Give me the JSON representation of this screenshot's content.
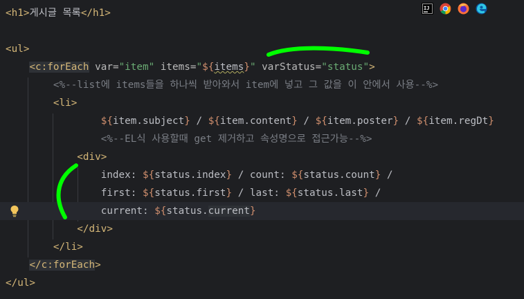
{
  "lines": [
    {
      "parts": [
        {
          "c": "tag",
          "t": "<h1>"
        },
        {
          "c": "txt",
          "t": "게시글 목록"
        },
        {
          "c": "tag",
          "t": "</h1>"
        }
      ]
    },
    {
      "parts": []
    },
    {
      "parts": [
        {
          "c": "tag",
          "t": "<ul>"
        }
      ]
    },
    {
      "parts": [
        {
          "c": "txt",
          "t": "    "
        },
        {
          "c": "tag hl",
          "t": "<c:forEach"
        },
        {
          "c": "attr",
          "t": " var="
        },
        {
          "c": "str",
          "t": "\"item\""
        },
        {
          "c": "attr",
          "t": " items="
        },
        {
          "c": "str",
          "t": "\""
        },
        {
          "c": "el",
          "t": "${"
        },
        {
          "c": "txt warn",
          "t": "items"
        },
        {
          "c": "el",
          "t": "}"
        },
        {
          "c": "str",
          "t": "\""
        },
        {
          "c": "attr",
          "t": " varStatus="
        },
        {
          "c": "str",
          "t": "\"status\""
        },
        {
          "c": "tag",
          "t": ">"
        }
      ]
    },
    {
      "parts": [
        {
          "c": "txt",
          "t": "        "
        },
        {
          "c": "cmt",
          "t": "<%--list에 items들을 하나씩 받아와서 item에 넣고 그 값을 이 안에서 사용--%>"
        }
      ]
    },
    {
      "parts": [
        {
          "c": "txt",
          "t": "        "
        },
        {
          "c": "tag",
          "t": "<li>"
        }
      ]
    },
    {
      "parts": [
        {
          "c": "txt",
          "t": "                "
        },
        {
          "c": "el",
          "t": "${"
        },
        {
          "c": "txt",
          "t": "item.subject"
        },
        {
          "c": "el",
          "t": "}"
        },
        {
          "c": "txt",
          "t": " / "
        },
        {
          "c": "el",
          "t": "${"
        },
        {
          "c": "txt",
          "t": "item.content"
        },
        {
          "c": "el",
          "t": "}"
        },
        {
          "c": "txt",
          "t": " / "
        },
        {
          "c": "el",
          "t": "${"
        },
        {
          "c": "txt",
          "t": "item.poster"
        },
        {
          "c": "el",
          "t": "}"
        },
        {
          "c": "txt",
          "t": " / "
        },
        {
          "c": "el",
          "t": "${"
        },
        {
          "c": "txt",
          "t": "item.regDt"
        },
        {
          "c": "el",
          "t": "}"
        }
      ]
    },
    {
      "parts": [
        {
          "c": "txt",
          "t": "                "
        },
        {
          "c": "cmt",
          "t": "<%--EL식 사용할때 get 제거하고 속성명으로 접근가능--%>"
        }
      ]
    },
    {
      "parts": [
        {
          "c": "txt",
          "t": "            "
        },
        {
          "c": "tag",
          "t": "<div>"
        }
      ]
    },
    {
      "parts": [
        {
          "c": "txt",
          "t": "                index: "
        },
        {
          "c": "el",
          "t": "${"
        },
        {
          "c": "txt",
          "t": "status.index"
        },
        {
          "c": "el",
          "t": "}"
        },
        {
          "c": "txt",
          "t": " / count: "
        },
        {
          "c": "el",
          "t": "${"
        },
        {
          "c": "txt",
          "t": "status.count"
        },
        {
          "c": "el",
          "t": "}"
        },
        {
          "c": "txt",
          "t": " /"
        }
      ]
    },
    {
      "parts": [
        {
          "c": "txt",
          "t": "                first: "
        },
        {
          "c": "el",
          "t": "${"
        },
        {
          "c": "txt",
          "t": "status.first"
        },
        {
          "c": "el",
          "t": "}"
        },
        {
          "c": "txt",
          "t": " / last: "
        },
        {
          "c": "el",
          "t": "${"
        },
        {
          "c": "txt",
          "t": "status.last"
        },
        {
          "c": "el",
          "t": "}"
        },
        {
          "c": "txt",
          "t": " /"
        }
      ]
    },
    {
      "parts": [
        {
          "c": "txt",
          "t": "                current: "
        },
        {
          "c": "el",
          "t": "${"
        },
        {
          "c": "txt",
          "t": "status."
        },
        {
          "c": "txt hl",
          "t": "current"
        },
        {
          "c": "el",
          "t": "}"
        }
      ]
    },
    {
      "parts": [
        {
          "c": "txt",
          "t": "            "
        },
        {
          "c": "tag",
          "t": "</div>"
        }
      ]
    },
    {
      "parts": [
        {
          "c": "txt",
          "t": "        "
        },
        {
          "c": "tag",
          "t": "</li>"
        }
      ]
    },
    {
      "parts": [
        {
          "c": "txt",
          "t": "    "
        },
        {
          "c": "tag hl",
          "t": "</c:forEach"
        },
        {
          "c": "tag",
          "t": ">"
        }
      ]
    },
    {
      "parts": [
        {
          "c": "tag",
          "t": "</ul>"
        }
      ]
    }
  ],
  "current_line_index": 11,
  "toolbar": {
    "icons": [
      "intellij-icon",
      "chrome-icon",
      "firefox-icon",
      "edge-icon"
    ],
    "intellij_label": "IJ"
  },
  "colors": {
    "background": "#1e1f22",
    "tag": "#d5b778",
    "string": "#6aab73",
    "el_brace": "#cf8e6d",
    "comment": "#7a7e85",
    "annotation": "#00ff00"
  }
}
